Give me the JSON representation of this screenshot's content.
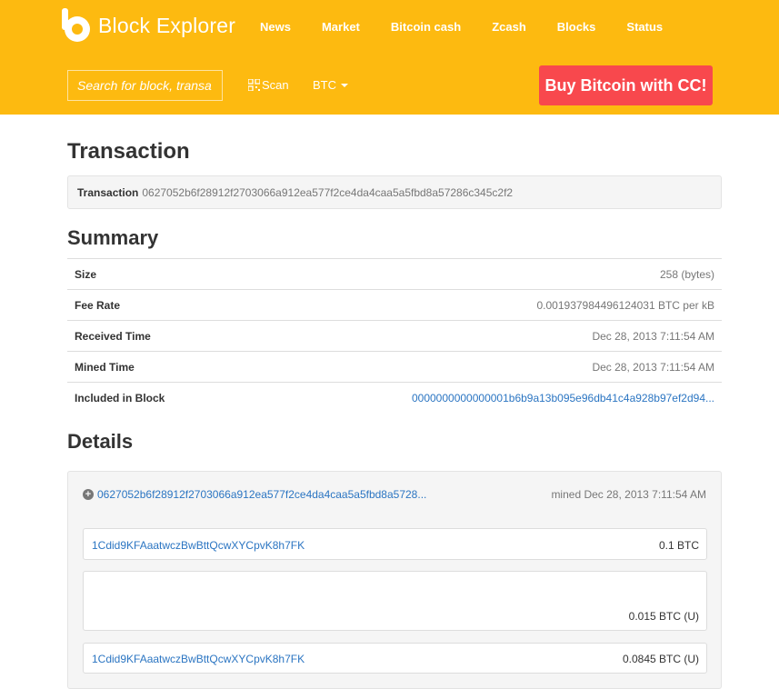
{
  "header": {
    "logo_text": "Block Explorer",
    "nav": [
      "News",
      "Market",
      "Bitcoin cash",
      "Zcash",
      "Blocks",
      "Status"
    ],
    "search_placeholder": "Search for block, transa",
    "scan_label": "Scan",
    "currency": "BTC",
    "buy_button": "Buy Bitcoin with CC!"
  },
  "colors": {
    "brand": "#fdba10",
    "buy": "#f8484d",
    "link": "#2b75c2"
  },
  "transaction": {
    "heading": "Transaction",
    "label": "Transaction",
    "hash": "0627052b6f28912f2703066a912ea577f2ce4da4caa5a5fbd8a57286c345c2f2"
  },
  "summary": {
    "heading": "Summary",
    "rows": [
      {
        "label": "Size",
        "value": "258 (bytes)"
      },
      {
        "label": "Fee Rate",
        "value": "0.001937984496124031 BTC per kB"
      },
      {
        "label": "Received Time",
        "value": "Dec 28, 2013 7:11:54 AM"
      },
      {
        "label": "Mined Time",
        "value": "Dec 28, 2013 7:11:54 AM"
      },
      {
        "label": "Included in Block",
        "value": "0000000000000001b6b9a13b095e96db41c4a928b97ef2d94..."
      }
    ]
  },
  "details": {
    "heading": "Details",
    "tx_link": "0627052b6f28912f2703066a912ea577f2ce4da4caa5a5fbd8a5728...",
    "mined": "mined Dec 28, 2013 7:11:54 AM",
    "input": {
      "address": "1Cdid9KFAaatwczBwBttQcwXYCpvK8h7FK",
      "amount": "0.1 BTC"
    },
    "outputs": [
      {
        "address": "",
        "amount": "0.015 BTC (U)"
      },
      {
        "address": "1Cdid9KFAaatwczBwBttQcwXYCpvK8h7FK",
        "amount": "0.0845 BTC (U)"
      }
    ]
  }
}
